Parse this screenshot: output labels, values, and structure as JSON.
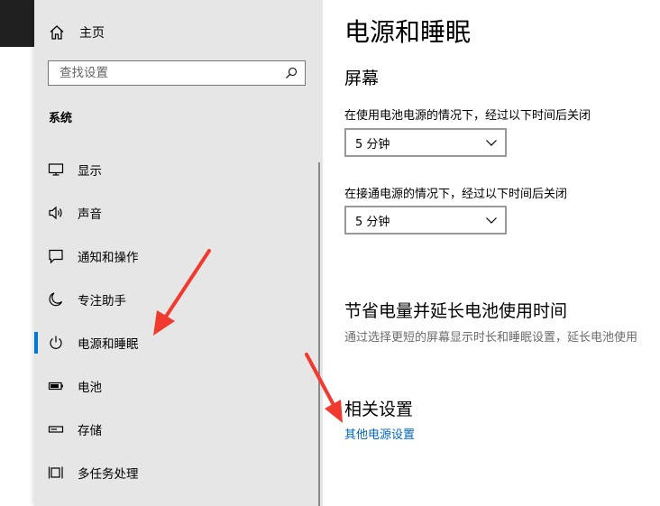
{
  "sidebar": {
    "home_label": "主页",
    "search_placeholder": "查找设置",
    "section_title": "系统",
    "items": [
      {
        "label": "显示",
        "icon": "monitor-icon"
      },
      {
        "label": "声音",
        "icon": "speaker-icon"
      },
      {
        "label": "通知和操作",
        "icon": "message-icon"
      },
      {
        "label": "专注助手",
        "icon": "moon-icon"
      },
      {
        "label": "电源和睡眠",
        "icon": "power-icon",
        "active": true
      },
      {
        "label": "电池",
        "icon": "battery-icon"
      },
      {
        "label": "存储",
        "icon": "storage-drive-icon"
      },
      {
        "label": "多任务处理",
        "icon": "multitask-icon"
      }
    ]
  },
  "main": {
    "title": "电源和睡眠",
    "screen": {
      "heading": "屏幕",
      "battery_caption": "在使用电池电源的情况下，经过以下时间后关闭",
      "battery_value": "5 分钟",
      "plugged_caption": "在接通电源的情况下，经过以下时间后关闭",
      "plugged_value": "5 分钟"
    },
    "save": {
      "heading": "节省电量并延长电池使用时间",
      "description": "通过选择更短的屏幕显示时长和睡眠设置，延长电池使用"
    },
    "related": {
      "heading": "相关设置",
      "link": "其他电源设置"
    }
  },
  "colors": {
    "accent": "#0078d7",
    "link": "#0067c0",
    "arrow": "#f03a2e",
    "sidebar_bg": "#e6e6e6"
  }
}
